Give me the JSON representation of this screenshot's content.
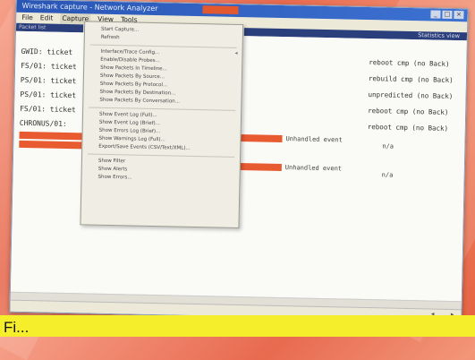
{
  "window": {
    "title": "Wireshark capture - Network Analyzer"
  },
  "menubar": {
    "items": [
      "File",
      "Edit",
      "Capture",
      "View",
      "Tools"
    ]
  },
  "tabs": {
    "left": "Packet list",
    "right": "Statistics view"
  },
  "dropdown": {
    "top_items": [
      "Start Capture...",
      "Refresh"
    ],
    "group1": [
      "Interface/Trace Config...",
      "Enable/Disable Probes...",
      "Show Packets In Timeline...",
      "Show Packets By Source...",
      "Show Packets By Protocol...",
      "Show Packets By Destination...",
      "Show Packets By Conversation..."
    ],
    "group2": [
      "Show Event Log (Full)...",
      "Show Event Log (Brief)...",
      "Show Errors Log (Brief)...",
      "Show Warnings Log (Full)...",
      "Export/Save Events (CSV/Text/XML)..."
    ],
    "group3": [
      "Show Filter",
      "Show Alerts",
      "Show Errors..."
    ]
  },
  "rows": [
    {
      "left": "GWID: ticket",
      "status": "reboot cmp (no Back)"
    },
    {
      "left": "FS/01: ticket",
      "status": "rebuild cmp (no Back)"
    },
    {
      "left": "PS/01: ticket",
      "status": "unpredicted (no Back)"
    },
    {
      "left": "PS/01: ticket",
      "status": "reboot cmp (no Back)"
    },
    {
      "left": "FS/01: ticket",
      "status": "reboot cmp (no Back)"
    },
    {
      "left": "CHRONUS/01:",
      "status": ""
    }
  ],
  "events": [
    {
      "text": "Unhandled event",
      "col": "n/a"
    },
    {
      "text": "Unhandled event",
      "col": "n/a"
    }
  ],
  "caption": {
    "text": "Fi..."
  },
  "colors": {
    "accent_red": "#e85a30",
    "navy": "#2b3f7c",
    "highlight_yellow": "#f5ee2a"
  }
}
